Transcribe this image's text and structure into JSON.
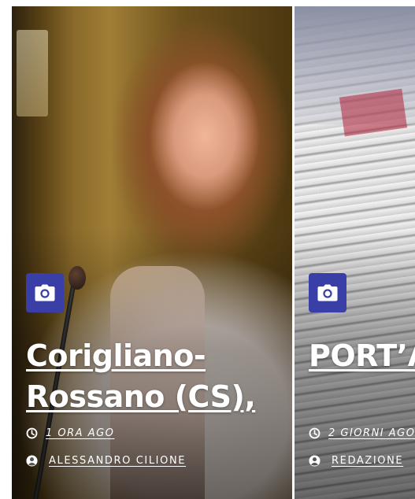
{
  "cards": [
    {
      "title": "Corigliano-Rossano (CS),",
      "time": "1 ORA AGO",
      "author": "ALESSANDRO CILIONE"
    },
    {
      "title": "PORT’A CLAAI:",
      "time": "2 GIORNI AGO",
      "author": "REDAZIONE"
    }
  ],
  "icons": {
    "badge": "camera-icon",
    "time": "clock-icon",
    "author": "user-icon"
  },
  "colors": {
    "badge_background": "#3a3fa8",
    "text": "#ffffff"
  }
}
